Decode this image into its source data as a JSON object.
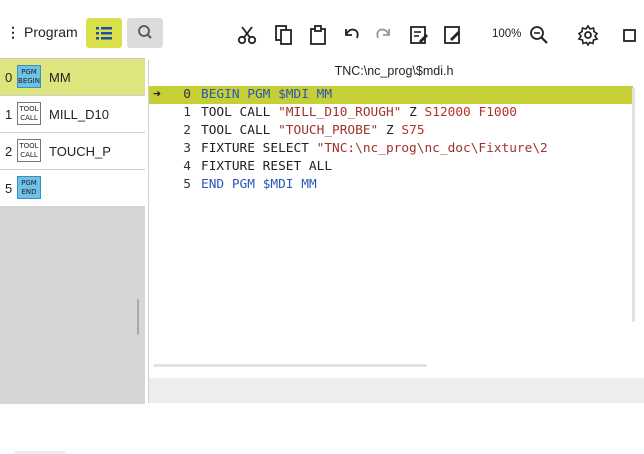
{
  "toolbar": {
    "program_label": "Program",
    "zoom_label": "100%",
    "icons": [
      "list-icon",
      "search-icon",
      "cut-icon",
      "copy-icon",
      "paste-icon",
      "undo-icon",
      "redo-icon",
      "edit-block-icon",
      "edit-icon",
      "zoom-icon",
      "settings-icon",
      "window-icon"
    ]
  },
  "program_list": [
    {
      "num": "0",
      "badge": [
        "PGM",
        "BEGIN"
      ],
      "badge_color": "blue",
      "name": "MM",
      "selected": true
    },
    {
      "num": "1",
      "badge": [
        "TOOL",
        "CALL"
      ],
      "badge_color": "white",
      "name": "MILL_D10",
      "selected": false
    },
    {
      "num": "2",
      "badge": [
        "TOOL",
        "CALL"
      ],
      "badge_color": "white",
      "name": "TOUCH_P",
      "selected": false
    },
    {
      "num": "5",
      "badge": [
        "PGM",
        "END"
      ],
      "badge_color": "blue",
      "name": "",
      "selected": false
    }
  ],
  "editor": {
    "title": "TNC:\\nc_prog\\$mdi.h",
    "current_line_index": 0,
    "lines": [
      {
        "num": "0",
        "text": "BEGIN PGM $MDI MM"
      },
      {
        "num": "1",
        "text": "TOOL CALL \"MILL_D10_ROUGH\" Z S12000 F1000"
      },
      {
        "num": "2",
        "text": "TOOL CALL \"TOUCH_PROBE\" Z S75"
      },
      {
        "num": "3",
        "text": "FIXTURE SELECT \"TNC:\\nc_prog\\nc_doc\\Fixture\\2"
      },
      {
        "num": "4",
        "text": "FIXTURE RESET ALL"
      },
      {
        "num": "5",
        "text": "END PGM $MDI MM"
      }
    ]
  },
  "colors": {
    "accent": "#d9e04a",
    "current_line": "#c6cf35",
    "selected_row": "#dde67e",
    "keyword": "#2b55b8",
    "string": "#a0322c",
    "badge_blue": "#6ec1e8"
  }
}
